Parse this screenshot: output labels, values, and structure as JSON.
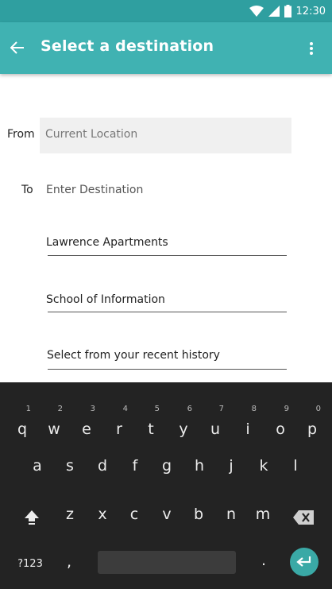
{
  "status_bar": {
    "time": "12:30",
    "icons": [
      "wifi-icon",
      "signal-icon",
      "battery-icon"
    ]
  },
  "app_bar": {
    "title": "Select a destination",
    "back_icon": "arrow-left-icon",
    "menu_icon": "more-vertical-icon"
  },
  "form": {
    "from_label": "From",
    "from_value": "Current Location",
    "to_label": "To",
    "to_placeholder": "Enter Destination"
  },
  "suggestions": [
    "Lawrence Apartments",
    "School of Information",
    "Select from your recent history"
  ],
  "keyboard": {
    "row1": [
      {
        "key": "q",
        "hint": "1"
      },
      {
        "key": "w",
        "hint": "2"
      },
      {
        "key": "e",
        "hint": "3"
      },
      {
        "key": "r",
        "hint": "4"
      },
      {
        "key": "t",
        "hint": "5"
      },
      {
        "key": "y",
        "hint": "6"
      },
      {
        "key": "u",
        "hint": "7"
      },
      {
        "key": "i",
        "hint": "8"
      },
      {
        "key": "o",
        "hint": "9"
      },
      {
        "key": "p",
        "hint": "0"
      }
    ],
    "row2": [
      "a",
      "s",
      "d",
      "f",
      "g",
      "h",
      "j",
      "k",
      "l"
    ],
    "row3": [
      "z",
      "x",
      "c",
      "v",
      "b",
      "n",
      "m"
    ],
    "symbols_key": "?123",
    "comma_key": ",",
    "period_key": ".",
    "shift_icon": "shift-icon",
    "backspace_icon": "backspace-icon",
    "enter_icon": "enter-icon"
  },
  "colors": {
    "status_bar": "#2f9fa0",
    "app_bar": "#40b2b2",
    "keyboard_bg": "#232323",
    "enter_key": "#3aa9a6"
  }
}
